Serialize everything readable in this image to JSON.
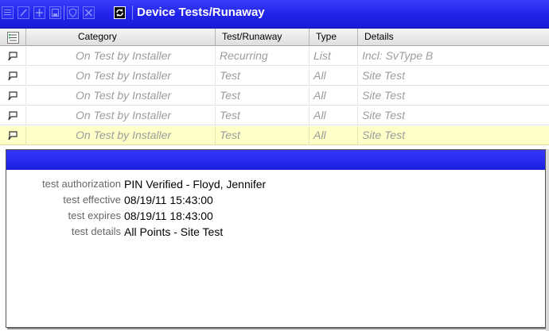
{
  "window": {
    "title": "Device Tests/Runaway"
  },
  "toolbar": {
    "icons": [
      "list-icon",
      "edit-icon",
      "add-icon",
      "save-icon",
      "shield-icon",
      "delete-icon",
      "refresh-icon"
    ]
  },
  "grid": {
    "columns": [
      "Category",
      "Test/Runaway",
      "Type",
      "Details"
    ],
    "rows": [
      {
        "category": "On Test by Installer",
        "test": "Recurring",
        "type": "List",
        "details": "Incl: SvType B",
        "selected": false
      },
      {
        "category": "On Test by Installer",
        "test": "Test",
        "type": "All",
        "details": "Site Test",
        "selected": false
      },
      {
        "category": "On Test by Installer",
        "test": "Test",
        "type": "All",
        "details": "Site Test",
        "selected": false
      },
      {
        "category": "On Test by Installer",
        "test": "Test",
        "type": "All",
        "details": "Site Test",
        "selected": false
      },
      {
        "category": "On Test by Installer",
        "test": "Test",
        "type": "All",
        "details": "Site Test",
        "selected": true
      }
    ]
  },
  "detail": {
    "fields": [
      {
        "label": "test authorization",
        "value": "PIN Verified - Floyd, Jennifer"
      },
      {
        "label": "test effective",
        "value": "08/19/11 15:43:00"
      },
      {
        "label": "test expires",
        "value": "08/19/11 18:43:00"
      },
      {
        "label": "test details",
        "value": "All Points - Site Test"
      }
    ]
  },
  "colors": {
    "titlebar": "#2024ec",
    "selected_row": "#ffffc8",
    "muted_text": "#9c9c9c"
  }
}
